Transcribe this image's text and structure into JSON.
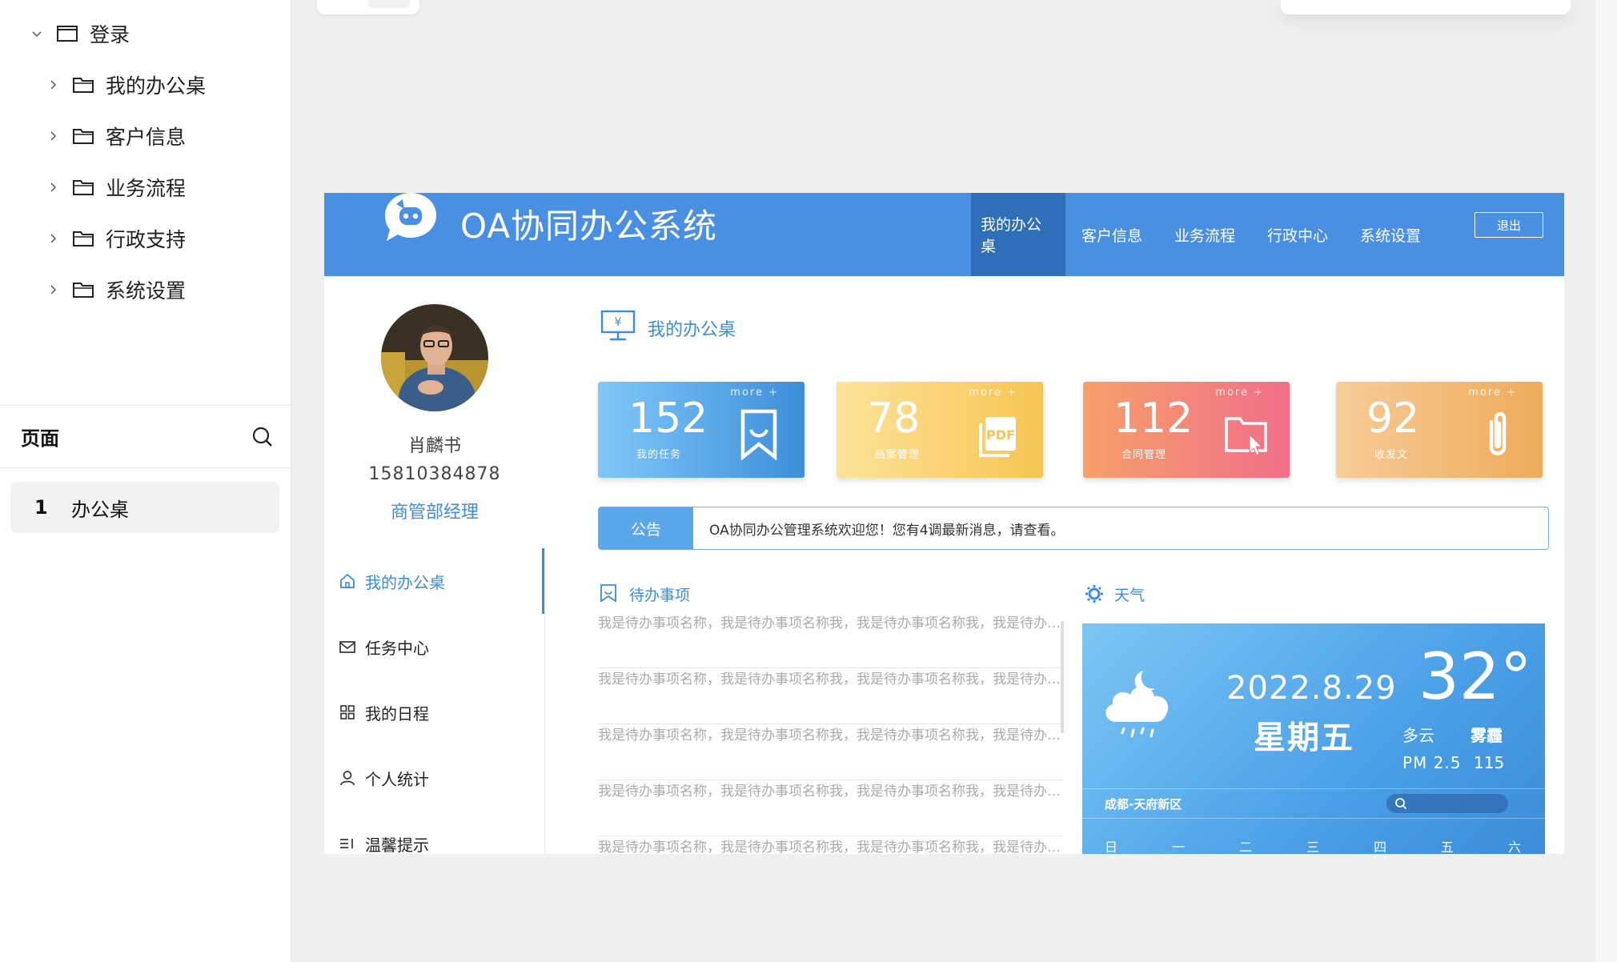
{
  "tree": {
    "root": {
      "label": "登录"
    },
    "children": [
      {
        "label": "我的办公桌"
      },
      {
        "label": "客户信息"
      },
      {
        "label": "业务流程"
      },
      {
        "label": "行政支持"
      },
      {
        "label": "系统设置"
      }
    ]
  },
  "pages_panel": {
    "title": "页面",
    "items": [
      {
        "number": "1",
        "label": "办公桌"
      }
    ]
  },
  "header": {
    "app_title": "OA协同办公系统",
    "nav": [
      {
        "label": "我的办公桌",
        "active": true
      },
      {
        "label": "客户信息"
      },
      {
        "label": "业务流程"
      },
      {
        "label": "行政中心"
      },
      {
        "label": "系统设置"
      }
    ],
    "logout_label": "退出"
  },
  "profile": {
    "name": "肖麟书",
    "phone": "15810384878",
    "role": "商管部经理"
  },
  "side_menu": [
    {
      "label": "我的办公桌",
      "icon": "home-icon",
      "active": true
    },
    {
      "label": "任务中心",
      "icon": "mail-icon"
    },
    {
      "label": "我的日程",
      "icon": "grid-icon"
    },
    {
      "label": "个人统计",
      "icon": "user-icon"
    },
    {
      "label": "温馨提示",
      "icon": "list-icon"
    }
  ],
  "desk": {
    "title": "我的办公桌"
  },
  "cards": [
    {
      "number": "152",
      "label": "我的任务",
      "more": "more +",
      "icon": "bookmark-icon"
    },
    {
      "number": "78",
      "label": "档案管理",
      "more": "more +",
      "icon": "pdf-icon"
    },
    {
      "number": "112",
      "label": "合同管理",
      "more": "more +",
      "icon": "folder-icon"
    },
    {
      "number": "92",
      "label": "收发文",
      "more": "more +",
      "icon": "paperclip-icon"
    }
  ],
  "notice": {
    "tag": "公告",
    "text": "OA协同办公管理系统欢迎您！您有4调最新消息，请查看。"
  },
  "todo": {
    "title": "待办事项",
    "items": [
      "我是待办事项名称，我是待办事项名称我，我是待办事项名称我，我是待办事项名称",
      "我是待办事项名称，我是待办事项名称我，我是待办事项名称我，我是待办事项名称",
      "我是待办事项名称，我是待办事项名称我，我是待办事项名称我，我是待办事项名称",
      "我是待办事项名称，我是待办事项名称我，我是待办事项名称我，我是待办事项名称",
      "我是待办事项名称，我是待办事项名称我，我是待办事项名称我，我是待办事项名称"
    ]
  },
  "weather": {
    "title": "天气",
    "date": "2022.8.29",
    "weekday": "星期五",
    "temperature": "32°",
    "condition": "多云",
    "condition2": "雾霾",
    "pm_label": "PM 2.5",
    "pm_value": "115",
    "location": "成都-天府新区",
    "days": [
      "日",
      "一",
      "二",
      "三",
      "四",
      "五",
      "六"
    ]
  },
  "colors": {
    "header_bg": "#4a90e2",
    "nav_active_bg": "#2f6fb9",
    "accent": "#3b8ede"
  }
}
